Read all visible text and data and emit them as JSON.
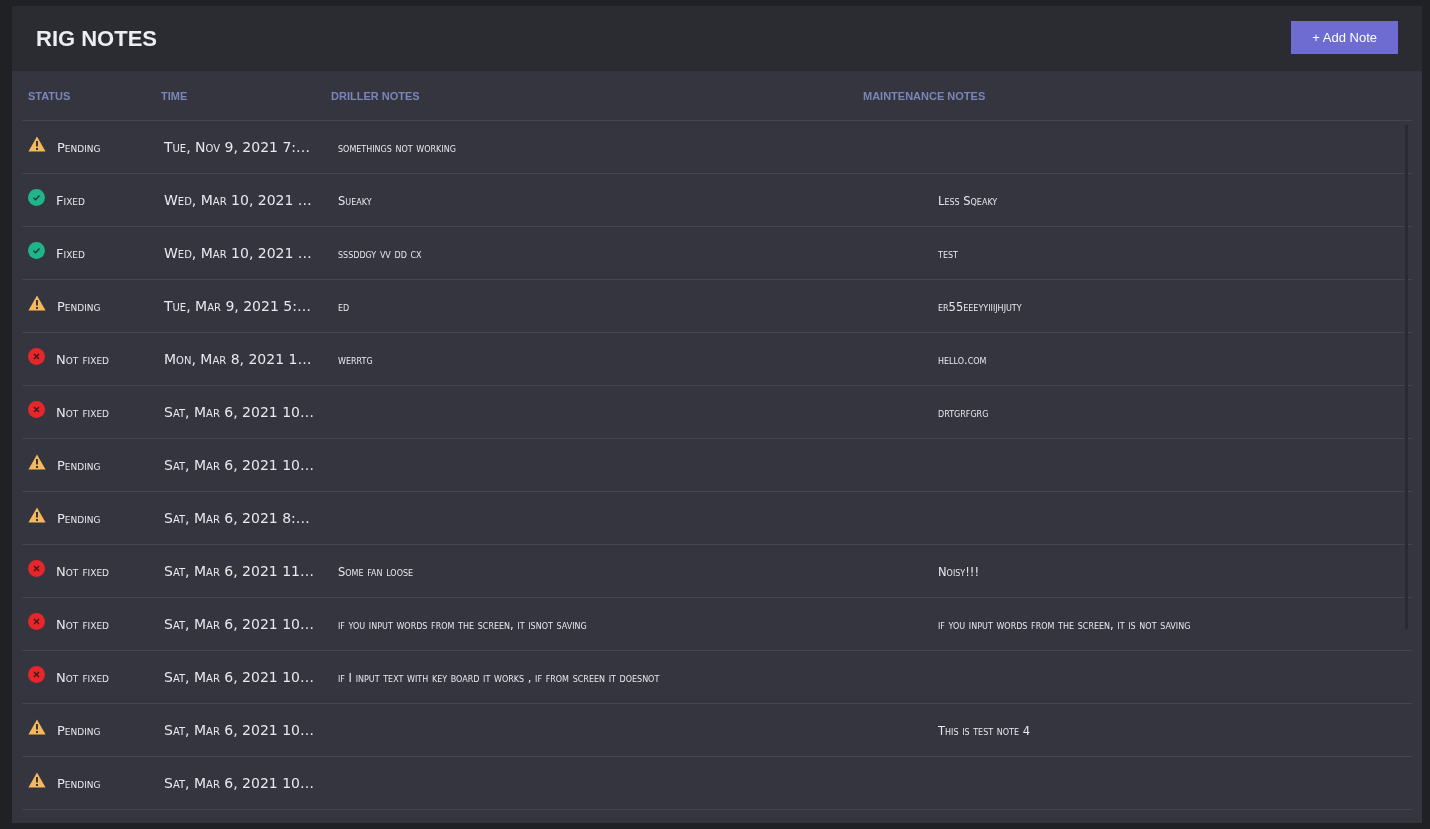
{
  "header": {
    "title": "RIG NOTES",
    "add_button": "+ Add Note"
  },
  "table": {
    "columns": [
      "STATUS",
      "TIME",
      "DRILLER NOTES",
      "MAINTENANCE NOTES"
    ],
    "rows": [
      {
        "status": {
          "kind": "pending",
          "label": "Pending"
        },
        "time": "Tue, Nov 9, 2021 7:…",
        "driller": "somethings not working",
        "maintenance": ""
      },
      {
        "status": {
          "kind": "fixed",
          "label": "Fixed"
        },
        "time": "Wed, Mar 10, 2021 …",
        "driller": "Sueaky",
        "maintenance": "Less Sqeaky"
      },
      {
        "status": {
          "kind": "fixed",
          "label": "Fixed"
        },
        "time": "Wed, Mar 10, 2021 …",
        "driller": "sssddgy vv dd cx",
        "maintenance": "test"
      },
      {
        "status": {
          "kind": "pending",
          "label": "Pending"
        },
        "time": "Tue, Mar 9, 2021 5:…",
        "driller": "ed",
        "maintenance": "er55eeeyyiiijhjuty"
      },
      {
        "status": {
          "kind": "not_fixed",
          "label": "Not fixed"
        },
        "time": "Mon, Mar 8, 2021 1…",
        "driller": "werrtg",
        "maintenance": "hello.com"
      },
      {
        "status": {
          "kind": "not_fixed",
          "label": "Not fixed"
        },
        "time": "Sat, Mar 6, 2021 10…",
        "driller": "",
        "maintenance": "drtgrfgrg"
      },
      {
        "status": {
          "kind": "pending",
          "label": "Pending"
        },
        "time": "Sat, Mar 6, 2021 10…",
        "driller": "",
        "maintenance": ""
      },
      {
        "status": {
          "kind": "pending",
          "label": "Pending"
        },
        "time": "Sat, Mar 6, 2021 8:…",
        "driller": "",
        "maintenance": ""
      },
      {
        "status": {
          "kind": "not_fixed",
          "label": "Not fixed"
        },
        "time": "Sat, Mar 6, 2021 11…",
        "driller": "Some fan loose",
        "maintenance": "Noisy!!!"
      },
      {
        "status": {
          "kind": "not_fixed",
          "label": "Not fixed"
        },
        "time": "Sat, Mar 6, 2021 10…",
        "driller": "if you input words from the screen, it isnot saving",
        "maintenance": "if you input words from the screen, it is not saving"
      },
      {
        "status": {
          "kind": "not_fixed",
          "label": "Not fixed"
        },
        "time": "Sat, Mar 6, 2021 10…",
        "driller": "if I input text with key board it works , if from screen it doesnot",
        "maintenance": ""
      },
      {
        "status": {
          "kind": "pending",
          "label": "Pending"
        },
        "time": "Sat, Mar 6, 2021 10…",
        "driller": "",
        "maintenance": "This is test note 4"
      },
      {
        "status": {
          "kind": "pending",
          "label": "Pending"
        },
        "time": "Sat, Mar 6, 2021 10…",
        "driller": "",
        "maintenance": ""
      }
    ]
  }
}
